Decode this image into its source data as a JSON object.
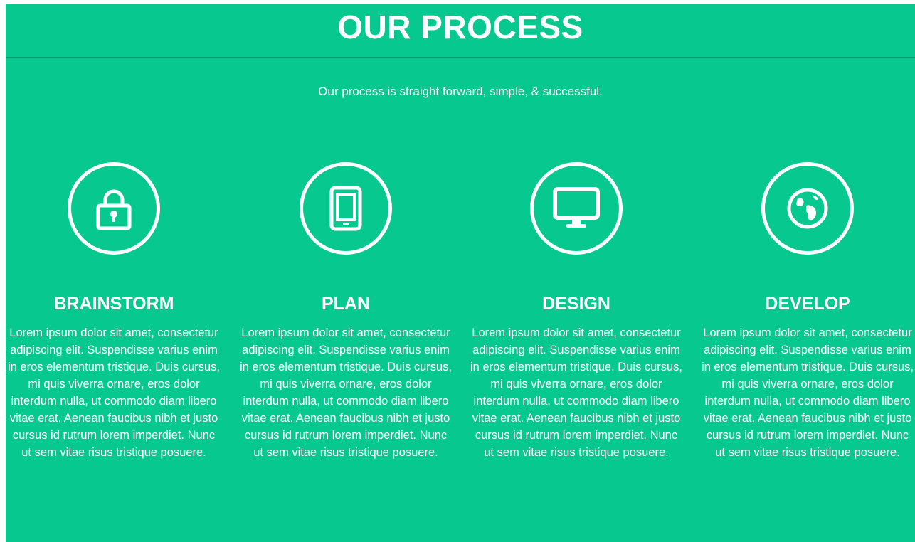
{
  "section": {
    "title": "OUR PROCESS",
    "subtitle": "Our process is straight forward, simple, & successful."
  },
  "steps": [
    {
      "icon": "lock-icon",
      "heading": "BRAINSTORM",
      "text": "Lorem ipsum dolor sit amet, consectetur adipiscing elit. Suspendisse varius enim in eros elementum tristique. Duis cursus, mi quis viverra ornare, eros dolor interdum nulla, ut commodo diam libero vitae erat. Aenean faucibus nibh et justo cursus id rutrum lorem imperdiet. Nunc ut sem vitae risus tristique posuere."
    },
    {
      "icon": "tablet-icon",
      "heading": "PLAN",
      "text": "Lorem ipsum dolor sit amet, consectetur adipiscing elit. Suspendisse varius enim in eros elementum tristique. Duis cursus, mi quis viverra ornare, eros dolor interdum nulla, ut commodo diam libero vitae erat. Aenean faucibus nibh et justo cursus id rutrum lorem imperdiet. Nunc ut sem vitae risus tristique posuere."
    },
    {
      "icon": "monitor-icon",
      "heading": "DESIGN",
      "text": "Lorem ipsum dolor sit amet, consectetur adipiscing elit. Suspendisse varius enim in eros elementum tristique. Duis cursus, mi quis viverra ornare, eros dolor interdum nulla, ut commodo diam libero vitae erat. Aenean faucibus nibh et justo cursus id rutrum lorem imperdiet. Nunc ut sem vitae risus tristique posuere."
    },
    {
      "icon": "globe-icon",
      "heading": "DEVELOP",
      "text": "Lorem ipsum dolor sit amet, consectetur adipiscing elit. Suspendisse varius enim in eros elementum tristique. Duis cursus, mi quis viverra ornare, eros dolor interdum nulla, ut commodo diam libero vitae erat. Aenean faucibus nibh et justo cursus id rutrum lorem imperdiet. Nunc ut sem vitae risus tristique posuere."
    }
  ],
  "colors": {
    "background": "#07c98f",
    "text": "#ffffff"
  }
}
